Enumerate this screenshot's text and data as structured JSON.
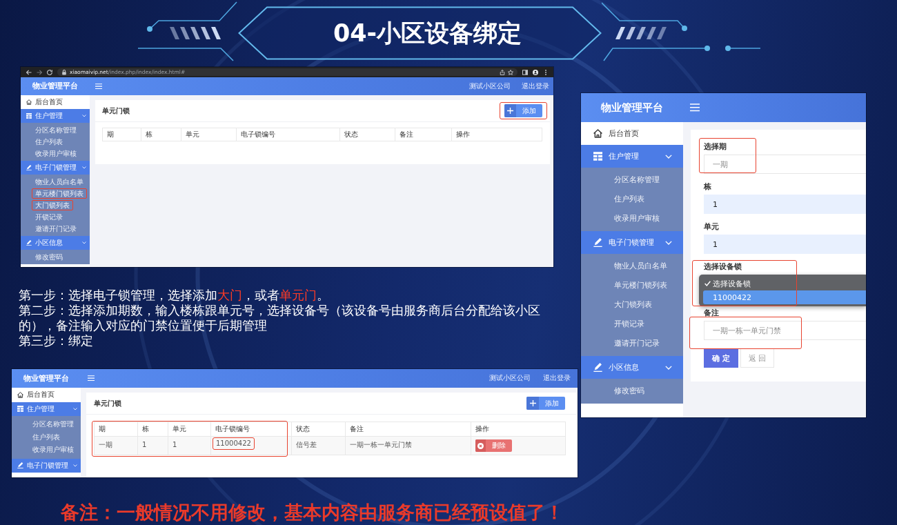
{
  "title": "04-小区设备绑定",
  "list_screenshot": {
    "browser": {
      "host": "xiaomaivip.net",
      "path": "/index.php/index/index.html#"
    },
    "app_name": "物业管理平台",
    "header_links": [
      "测试小区公司",
      "退出登录"
    ],
    "sidebar": [
      {
        "kind": "link",
        "label": "后台首页"
      },
      {
        "kind": "group",
        "label": "住户管理",
        "expanded": true,
        "children": [
          {
            "label": "分区名称管理",
            "highlighted": false
          },
          {
            "label": "住户列表",
            "highlighted": false
          },
          {
            "label": "收录用户审核",
            "highlighted": false
          }
        ]
      },
      {
        "kind": "group",
        "label": "电子门锁管理",
        "expanded": true,
        "children": [
          {
            "label": "物业人员白名单",
            "highlighted": false
          },
          {
            "label": "单元楼门锁列表",
            "highlighted": true
          },
          {
            "label": "大门锁列表",
            "highlighted": true
          },
          {
            "label": "开锁记录",
            "highlighted": false
          },
          {
            "label": "邀请开门记录",
            "highlighted": false
          }
        ]
      },
      {
        "kind": "group",
        "label": "小区信息",
        "expanded": true,
        "children": [
          {
            "label": "修改密码",
            "highlighted": false
          }
        ]
      }
    ],
    "card_title": "单元门锁",
    "add_button": {
      "label": "添加",
      "highlighted": true
    },
    "table": {
      "columns": [
        {
          "label": "期"
        },
        {
          "label": "栋"
        },
        {
          "label": "单元"
        },
        {
          "label": "电子锁编号"
        },
        {
          "label": "状态"
        },
        {
          "label": "备注"
        },
        {
          "label": "操作"
        }
      ]
    }
  },
  "form_screenshot": {
    "app_name": "物业管理平台",
    "sidebar": [
      {
        "kind": "link",
        "label": "后台首页"
      },
      {
        "kind": "group",
        "label": "住户管理",
        "expanded": true,
        "children": [
          {
            "label": "分区名称管理"
          },
          {
            "label": "住户列表"
          },
          {
            "label": "收录用户审核"
          }
        ]
      },
      {
        "kind": "group",
        "label": "电子门锁管理",
        "expanded": true,
        "children": [
          {
            "label": "物业人员白名单"
          },
          {
            "label": "单元楼门锁列表"
          },
          {
            "label": "大门锁列表"
          },
          {
            "label": "开锁记录"
          },
          {
            "label": "邀请开门记录"
          }
        ]
      },
      {
        "kind": "group",
        "label": "小区信息",
        "expanded": true,
        "children": [
          {
            "label": "修改密码"
          }
        ]
      }
    ],
    "fields": [
      {
        "kind": "select",
        "label": "选择期",
        "value": "一期",
        "autofilled": false,
        "highlighted": true
      },
      {
        "kind": "input",
        "label": "栋",
        "value": "1",
        "autofilled": true,
        "highlighted": false
      },
      {
        "kind": "input",
        "label": "单元",
        "value": "1",
        "autofilled": true,
        "highlighted": false
      },
      {
        "kind": "dropdown",
        "label": "选择设备锁",
        "highlighted": true,
        "options": [
          {
            "label": "选择设备锁",
            "checked": true,
            "selected": false
          },
          {
            "label": "11000422",
            "checked": false,
            "selected": true
          }
        ]
      },
      {
        "kind": "input",
        "label": "备注",
        "value": "一期一栋一单元门禁",
        "autofilled": false,
        "highlighted": true
      }
    ],
    "buttons": [
      {
        "label": "确 定",
        "kind": "primary"
      },
      {
        "label": "返 回",
        "kind": "secondary"
      }
    ]
  },
  "steps": [
    {
      "segments": [
        {
          "text": "第一步：选择电子锁管理，选择添加",
          "highlighted": false
        },
        {
          "text": "大门",
          "highlighted": true
        },
        {
          "text": "，或者",
          "highlighted": false
        },
        {
          "text": "单元门",
          "highlighted": true
        },
        {
          "text": "。",
          "highlighted": false
        }
      ]
    },
    {
      "segments": [
        {
          "text": "第二步：选择添加期数，输入楼栋跟单元号，选择设备号（该设备号由服务商后台分配给该小区的），备注输入对应的门禁位置便于后期管理",
          "highlighted": false
        }
      ]
    },
    {
      "segments": [
        {
          "text": "第三步：绑定",
          "highlighted": false
        }
      ]
    }
  ],
  "result_screenshot": {
    "app_name": "物业管理平台",
    "header_links": [
      "测试小区公司",
      "退出登录"
    ],
    "sidebar": [
      {
        "kind": "link",
        "label": "后台首页"
      },
      {
        "kind": "group",
        "label": "住户管理",
        "expanded": true,
        "children": [
          {
            "label": "分区名称管理"
          },
          {
            "label": "住户列表"
          },
          {
            "label": "收录用户审核"
          }
        ]
      },
      {
        "kind": "group",
        "label": "电子门锁管理",
        "expanded": true
      }
    ],
    "card_title": "单元门锁",
    "add_button": {
      "label": "添加",
      "highlighted": false
    },
    "table": {
      "columns": [
        {
          "label": "期",
          "highlighted": true
        },
        {
          "label": "栋",
          "highlighted": true
        },
        {
          "label": "单元",
          "highlighted": true
        },
        {
          "label": "电子锁编号",
          "highlighted": true
        },
        {
          "label": "状态",
          "highlighted": false
        },
        {
          "label": "备注",
          "highlighted": false
        },
        {
          "label": "操作",
          "highlighted": false
        }
      ],
      "rows": [
        {
          "cells": [
            {
              "text": "一期",
              "highlighted": false
            },
            {
              "text": "1",
              "highlighted": false
            },
            {
              "text": "1",
              "highlighted": false
            },
            {
              "text": "11000422",
              "highlighted": true
            },
            {
              "text": "信号差",
              "highlighted": false
            },
            {
              "text": "一期一栋一单元门禁",
              "highlighted": false
            }
          ],
          "action": "删除"
        }
      ]
    }
  },
  "note": "备注：一般情况不用修改，基本内容由服务商已经预设值了！"
}
